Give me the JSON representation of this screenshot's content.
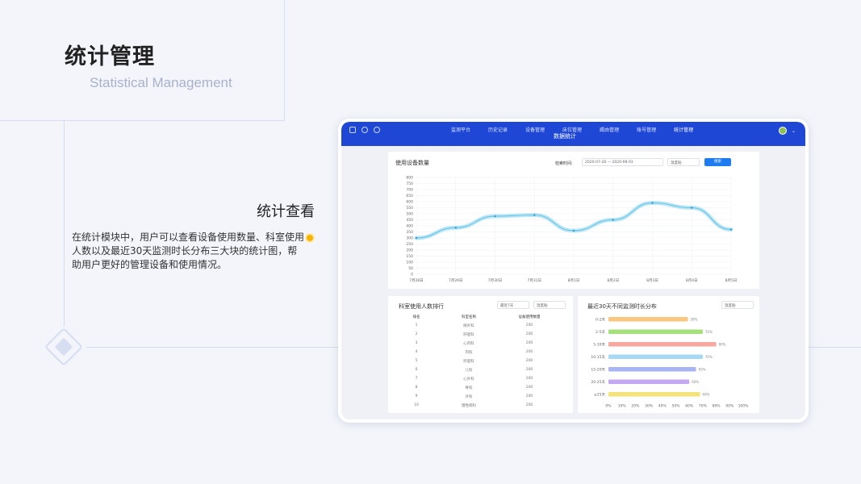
{
  "page": {
    "title": "统计管理",
    "subtitle": "Statistical Management",
    "section_title": "统计查看",
    "section_desc": "在统计模块中，用户可以查看设备使用数量、科室使用人数以及最近30天监测时长分布三大块的统计图，帮助用户更好的管理设备和使用情况。"
  },
  "app": {
    "nav": [
      "监测平台",
      "历史记录",
      "设备管理",
      "床位管理",
      "踢由管理",
      "账号管理",
      "统计管理"
    ],
    "nav_active": 6,
    "sub_title": "数据统计",
    "usage_card": {
      "title": "使用设备数量",
      "search_label": "检索时间:",
      "date_range": "2020-07-28 — 2020-08-03",
      "select": "温度贴",
      "button": "搜索"
    },
    "ranking_card": {
      "title": "科室使用人数排行",
      "select1": "最近7天",
      "select2": "温度贴",
      "headers": [
        "排名",
        "科室名称",
        "设备使用数量"
      ],
      "rows": [
        [
          "1",
          "眼外科",
          "200"
        ],
        [
          "2",
          "肝胆科",
          "200"
        ],
        [
          "3",
          "心内科",
          "200"
        ],
        [
          "4",
          "内科",
          "200"
        ],
        [
          "5",
          "肝胆科",
          "200"
        ],
        [
          "6",
          "儿科",
          "200"
        ],
        [
          "7",
          "心外科",
          "200"
        ],
        [
          "8",
          "骨科",
          "200"
        ],
        [
          "9",
          "外科",
          "200"
        ],
        [
          "10",
          "慢性病科",
          "200"
        ]
      ]
    },
    "dist_card": {
      "title": "最近30天不同监测时长分布",
      "select": "温度贴"
    }
  },
  "chart_data": [
    {
      "type": "line",
      "title": "使用设备数量",
      "x": [
        "7月28日",
        "7月29日",
        "7月30日",
        "7月31日",
        "8月1日",
        "8月2日",
        "8月3日",
        "8月4日",
        "8月5日"
      ],
      "series": [
        {
          "values": [
            300,
            385,
            480,
            490,
            360,
            450,
            590,
            550,
            370
          ]
        }
      ],
      "ylim": [
        0,
        800
      ],
      "yticks": [
        0,
        50,
        100,
        150,
        200,
        250,
        300,
        350,
        400,
        450,
        500,
        550,
        600,
        650,
        700,
        750,
        800
      ],
      "grid": true,
      "color": "#5bc3e6"
    },
    {
      "type": "bar",
      "orientation": "horizontal",
      "title": "最近30天不同监测时长分布",
      "categories": [
        "0-2天",
        "2-5天",
        "5-10天",
        "10-15天",
        "15-20天",
        "20-25天",
        "≥25天"
      ],
      "values": [
        59,
        70,
        80,
        70,
        65,
        60,
        68
      ],
      "value_labels": [
        "59%",
        "70%",
        "80%",
        "70%",
        "65%",
        "60%",
        "68%"
      ],
      "xticks": [
        "0%",
        "10%",
        "20%",
        "30%",
        "40%",
        "50%",
        "60%",
        "70%",
        "80%",
        "90%",
        "100%"
      ],
      "xlim": [
        0,
        100
      ],
      "colors": [
        "#f9c77f",
        "#a6e07a",
        "#f7a9a0",
        "#a6d8f4",
        "#a9b4f5",
        "#c5a8f3",
        "#f4e27a"
      ]
    }
  ]
}
